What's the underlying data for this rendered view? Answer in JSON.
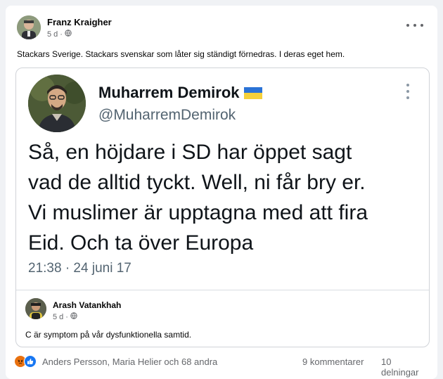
{
  "post": {
    "author": "Franz Kraigher",
    "time": "5 d",
    "text": "Stackars Sverige. Stackars svenskar som låter sig ständigt förnedras. I deras eget hem."
  },
  "tweet": {
    "name": "Muharrem Demirok",
    "handle": "@MuharremDemirok",
    "lines": [
      "Så, en höjdare i SD har öppet sagt",
      "vad de alltid tyckt. Well, ni får bry er.",
      "Vi muslimer är upptagna med att fira",
      "Eid. Och ta över Europa"
    ],
    "timestamp": "21:38 · 24 juni 17"
  },
  "comment": {
    "author": "Arash Vatankhah",
    "time": "5 d",
    "text": "C är symptom på vår dysfunktionella samtid."
  },
  "footer": {
    "reactions": [
      "angry",
      "like"
    ],
    "reaction_names": "Anders Persson, Maria Helier och 68 andra",
    "comments": "9 kommentarer",
    "shares": "10 delningar"
  },
  "colors": {
    "flag_blue": "#2b73d6",
    "flag_yellow": "#f5d03a",
    "like_blue": "#1877f2",
    "angry_orange": "#e9710f"
  }
}
